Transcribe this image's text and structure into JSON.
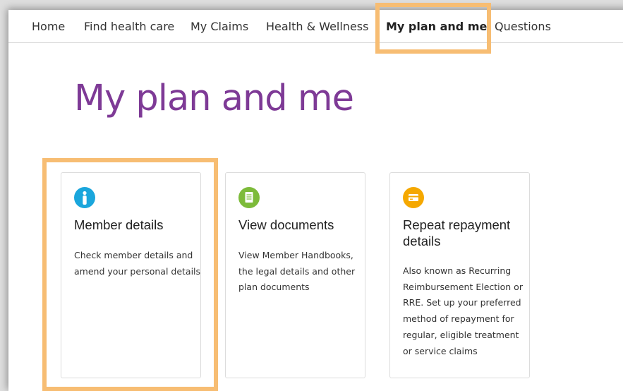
{
  "nav": {
    "items": [
      {
        "label": "Home"
      },
      {
        "label": "Find health care"
      },
      {
        "label": "My Claims"
      },
      {
        "label": "Health & Wellness"
      },
      {
        "label": "My plan and me",
        "active": true
      },
      {
        "label": "Questions"
      }
    ]
  },
  "page": {
    "title": "My plan and me"
  },
  "cards": [
    {
      "icon": "person-icon",
      "icon_color": "#1aa6dc",
      "title": "Member details",
      "description": "Check member details and amend your personal details"
    },
    {
      "icon": "document-icon",
      "icon_color": "#7dbb3a",
      "title": "View documents",
      "description": "View Member Handbooks, the legal details and other plan documents"
    },
    {
      "icon": "card-icon",
      "icon_color": "#f5a800",
      "title": "Repeat repayment details",
      "description": "Also known as Recurring Reimbursement Election or RRE. Set up your preferred method of repayment for regular, eligible treatment or service claims"
    }
  ],
  "colors": {
    "accent_title": "#7e3a96",
    "highlight": "#f7bd73"
  }
}
